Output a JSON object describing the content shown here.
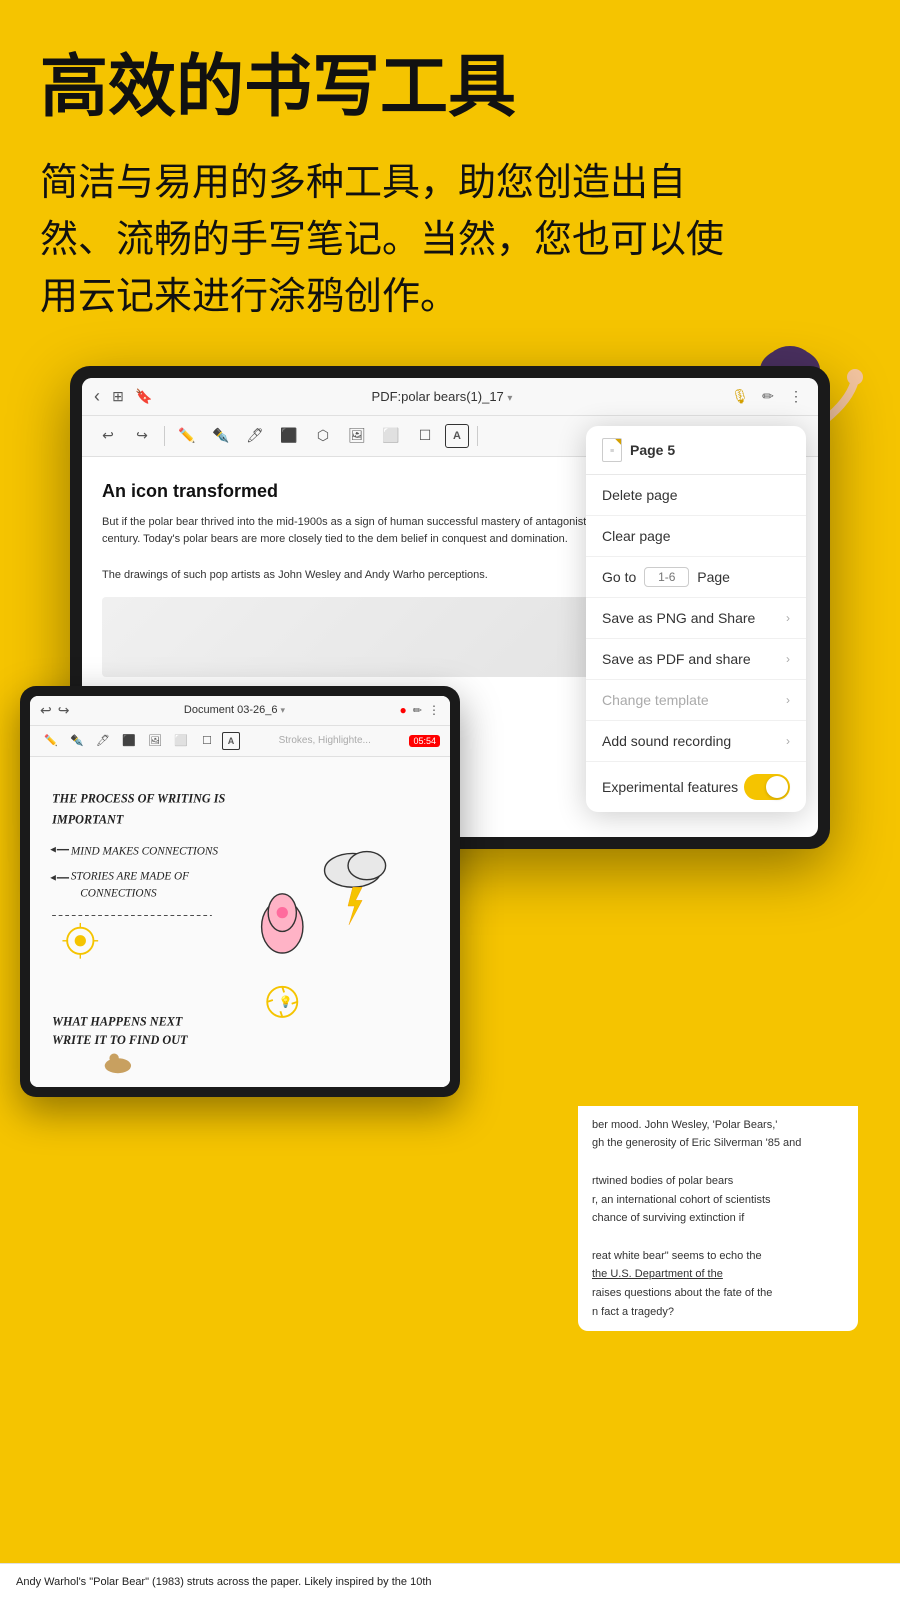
{
  "page": {
    "background_color": "#F5C400",
    "main_title": "高效的书写工具",
    "subtitle": "简洁与易用的多种工具，助您创造出自然、流畅的手写笔记。当然，您也可以使用云记来进行涂鸦创作。"
  },
  "ipad_main": {
    "toolbar": {
      "title": "PDF:polar bears(1)_17",
      "title_chevron": "▾",
      "back_icon": "‹",
      "mic_icon": "🎙",
      "pen_icon": "✏",
      "more_icon": "⋮"
    },
    "tools": [
      "↩",
      "↪",
      "|",
      "✏️",
      "✒️",
      "✏",
      "🔲",
      "⬜",
      "⬜",
      "☐",
      "⌨"
    ],
    "content": {
      "title": "An icon transformed",
      "body1": "But if the polar bear thrived into the mid-1900s as a sign of human successful mastery of antagonistic forces, this symbolic associatio 20th century. Today's polar bears are more closely tied to the dem belief in conquest and domination.",
      "body2": "The drawings of such pop artists as John Wesley and Andy Warho perceptions."
    }
  },
  "context_menu": {
    "page_label": "Page 5",
    "items": [
      {
        "label": "Delete page",
        "type": "normal"
      },
      {
        "label": "Clear page",
        "type": "normal"
      },
      {
        "label": "Go to",
        "type": "goto",
        "placeholder": "1-6",
        "suffix": "Page"
      },
      {
        "label": "Save as PNG and Share",
        "type": "arrow"
      },
      {
        "label": "Save as PDF and share",
        "type": "arrow"
      },
      {
        "label": "Change template",
        "type": "arrow",
        "disabled": true
      },
      {
        "label": "Add sound recording",
        "type": "arrow"
      },
      {
        "label": "Experimental features",
        "type": "toggle",
        "enabled": true
      }
    ]
  },
  "ipad_small": {
    "toolbar": {
      "title": "Document 03-26_6",
      "chevron": "▾",
      "record_icon": "●",
      "pen_icon": "✏",
      "more_icon": "⋮",
      "timer": "05:54"
    },
    "strokes_label": "Strokes, Highlighte...",
    "handwriting": [
      "THE PROCESS OF WRITING IS",
      "IMPORTANT",
      "→ MIND MAKES CONNECTIONS",
      "→ STORIES ARE MADE OF",
      "     CONNECTIONS",
      "WHAT HAPPENS NEXT",
      "WRITE IT TO FIND OUT"
    ]
  },
  "bottom_content": {
    "text1": "ber mood. John Wesley, 'Polar Bears,'",
    "text2": "gh the generosity of Eric Silverman '85 and",
    "text3": "rtwined bodies of polar bears",
    "text4": "r, an international cohort of scientists",
    "text5": "chance of surviving extinction if",
    "text6": "reat white bear\" seems to echo the",
    "text7": "the U.S. Department of the",
    "text8": "raises questions about the fate of the",
    "text9": "n fact a tragedy?",
    "bottom_text": "Andy Warhol's \"Polar Bear\" (1983) struts across the paper. Likely inspired by the 10th"
  }
}
